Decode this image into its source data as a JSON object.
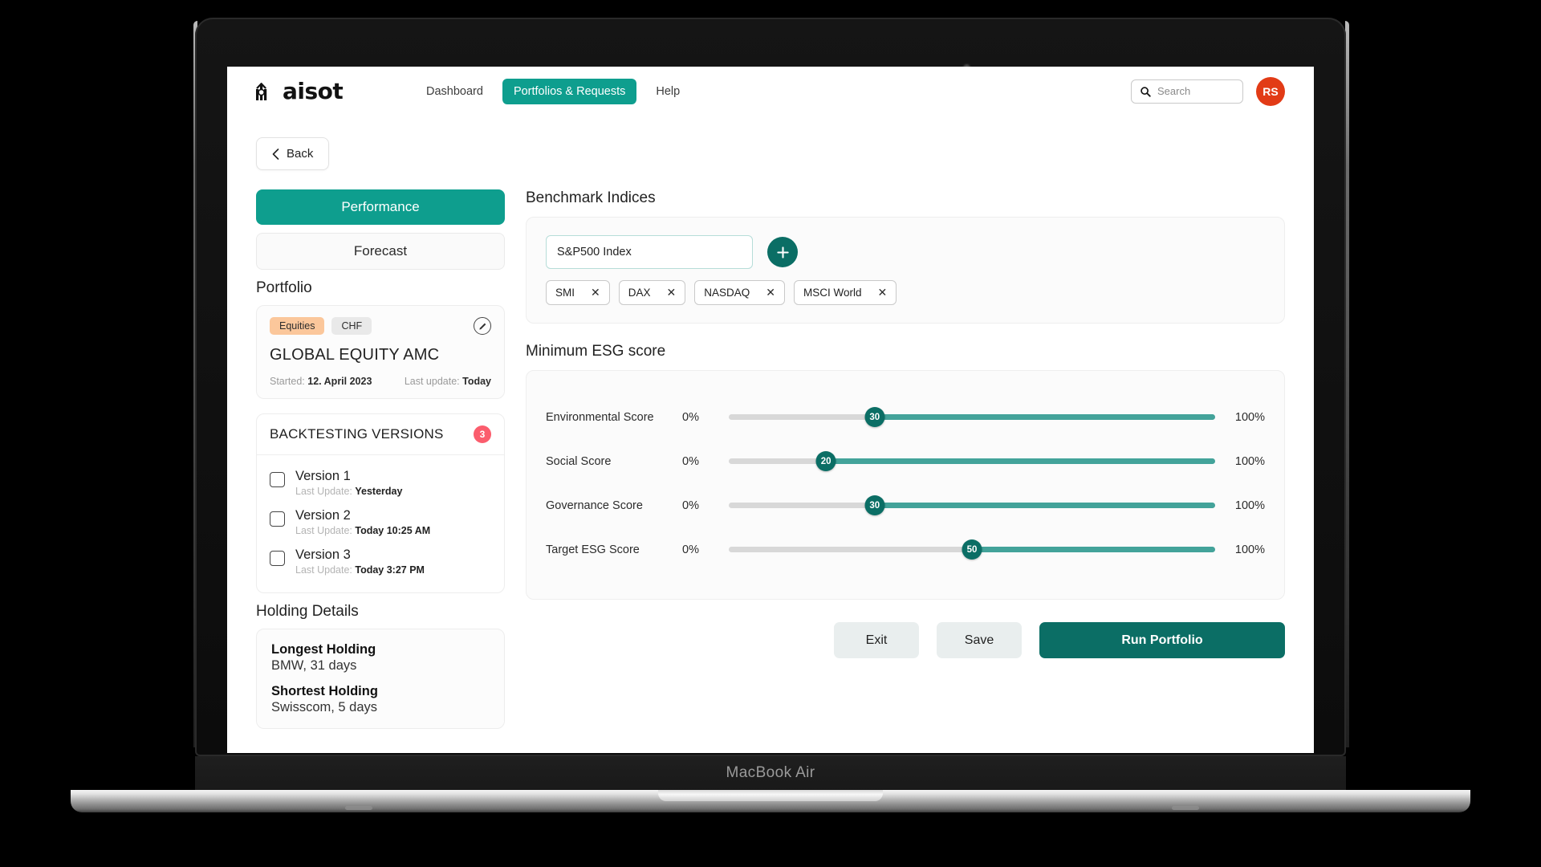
{
  "device": {
    "label": "MacBook Air"
  },
  "header": {
    "logo_text": "aisot",
    "logo_icon": "aisot-bars-logo-icon",
    "nav": [
      {
        "label": "Dashboard",
        "active": false
      },
      {
        "label": "Portfolios & Requests",
        "active": true
      },
      {
        "label": "Help",
        "active": false
      }
    ],
    "search": {
      "placeholder": "Search",
      "icon": "search-icon"
    },
    "avatar": {
      "initials": "RS",
      "color": "#e23b16"
    }
  },
  "back_button": {
    "label": "Back",
    "icon": "chevron-left-icon"
  },
  "sidebar": {
    "tabs": [
      {
        "label": "Performance",
        "active": true
      },
      {
        "label": "Forecast",
        "active": false
      }
    ],
    "portfolio_heading": "Portfolio",
    "portfolio_card": {
      "tag_asset": "Equities",
      "tag_currency": "CHF",
      "edit_icon": "pencil-icon",
      "name": "GLOBAL EQUITY AMC",
      "started_label": "Started:",
      "started_value": "12. April 2023",
      "last_update_label": "Last update:",
      "last_update_value": "Today"
    },
    "backtesting": {
      "title": "BACKTESTING VERSIONS",
      "badge_count": "3",
      "versions": [
        {
          "name": "Version 1",
          "update_label": "Last Update:",
          "update_value": "Yesterday",
          "checked": false
        },
        {
          "name": "Version 2",
          "update_label": "Last Update:",
          "update_value": "Today 10:25 AM",
          "checked": false
        },
        {
          "name": "Version 3",
          "update_label": "Last Update:",
          "update_value": "Today 3:27 PM",
          "checked": false
        }
      ]
    },
    "holding_heading": "Holding Details",
    "holdings": [
      {
        "title": "Longest Holding",
        "value": "BMW, 31 days"
      },
      {
        "title": "Shortest Holding",
        "value": "Swisscom, 5 days"
      }
    ]
  },
  "benchmark": {
    "title": "Benchmark Indices",
    "input_value": "S&P500 Index",
    "add_button_icon": "plus-icon",
    "tags": [
      {
        "label": "SMI",
        "remove_icon": "close-icon"
      },
      {
        "label": "DAX",
        "remove_icon": "close-icon"
      },
      {
        "label": "NASDAQ",
        "remove_icon": "close-icon"
      },
      {
        "label": "MSCI World",
        "remove_icon": "close-icon"
      }
    ]
  },
  "esg": {
    "title": "Minimum ESG score",
    "sliders": [
      {
        "label": "Environmental Score",
        "min_label": "0%",
        "max_label": "100%",
        "value": "30",
        "percent": 30
      },
      {
        "label": "Social Score",
        "min_label": "0%",
        "max_label": "100%",
        "value": "20",
        "percent": 20
      },
      {
        "label": "Governance Score",
        "min_label": "0%",
        "max_label": "100%",
        "value": "30",
        "percent": 30
      },
      {
        "label": "Target ESG Score",
        "min_label": "0%",
        "max_label": "100%",
        "value": "50",
        "percent": 50
      }
    ]
  },
  "actions": {
    "exit": "Exit",
    "save": "Save",
    "run": "Run Portfolio"
  },
  "colors": {
    "accent_teal": "#0e9e8e",
    "deep_teal": "#0b6e65",
    "track_fill": "#43a39a",
    "badge_red": "#fb5d6d",
    "avatar_red": "#e23b16",
    "chip_orange": "#fbc79b"
  }
}
